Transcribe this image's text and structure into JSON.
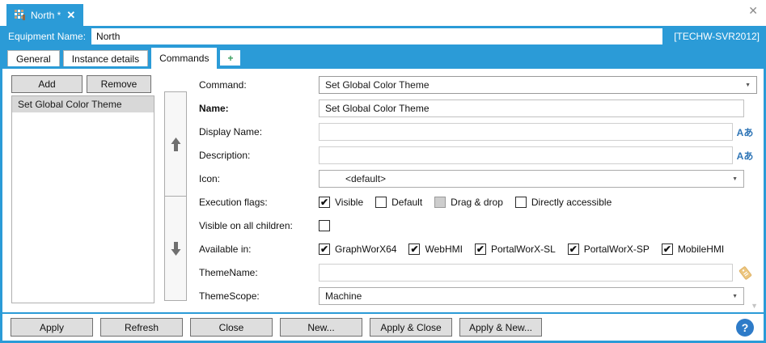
{
  "window": {
    "close_icon": "✕",
    "server_badge": "[TECHW-SVR2012]"
  },
  "doc_tab": {
    "title": "North *",
    "close_icon": "✕"
  },
  "equipment": {
    "label": "Equipment Name:",
    "value": "North"
  },
  "tabs": {
    "general": "General",
    "instance_details": "Instance details",
    "commands": "Commands",
    "add": "+"
  },
  "left_panel": {
    "add_label": "Add",
    "remove_label": "Remove",
    "items": [
      {
        "label": "Set Global Color Theme",
        "selected": true
      }
    ]
  },
  "form": {
    "command": {
      "label": "Command:",
      "value": "Set Global Color Theme"
    },
    "name": {
      "label": "Name:",
      "value": "Set Global Color Theme"
    },
    "display_name": {
      "label": "Display Name:",
      "value": "",
      "localize_icon": "Aあ"
    },
    "description": {
      "label": "Description:",
      "value": "",
      "localize_icon": "Aあ"
    },
    "icon": {
      "label": "Icon:",
      "value": "<default>"
    },
    "execution_flags": {
      "label": "Execution flags:",
      "options": [
        {
          "label": "Visible",
          "state": "checked"
        },
        {
          "label": "Default",
          "state": "unchecked"
        },
        {
          "label": "Drag & drop",
          "state": "indeterminate"
        },
        {
          "label": "Directly accessible",
          "state": "unchecked"
        }
      ]
    },
    "visible_on_all_children": {
      "label": "Visible on all children:",
      "state": "unchecked"
    },
    "available_in": {
      "label": "Available in:",
      "options": [
        {
          "label": "GraphWorX64",
          "state": "checked"
        },
        {
          "label": "WebHMI",
          "state": "checked"
        },
        {
          "label": "PortalWorX-SL",
          "state": "checked"
        },
        {
          "label": "PortalWorX-SP",
          "state": "checked"
        },
        {
          "label": "MobileHMI",
          "state": "checked"
        }
      ]
    },
    "theme_name": {
      "label": "ThemeName:",
      "value": ""
    },
    "theme_scope": {
      "label": "ThemeScope:",
      "value": "Machine"
    }
  },
  "footer": {
    "buttons": [
      "Apply",
      "Refresh",
      "Close",
      "New...",
      "Apply & Close",
      "Apply & New..."
    ],
    "help_label": "?"
  },
  "colors": {
    "accent_blue": "#2b9bd7",
    "help_blue": "#2e7bc8",
    "localize_blue": "#2e75b6",
    "tag_gold": "#ebc37f",
    "selected_item_gray": "#d8d8d8"
  }
}
